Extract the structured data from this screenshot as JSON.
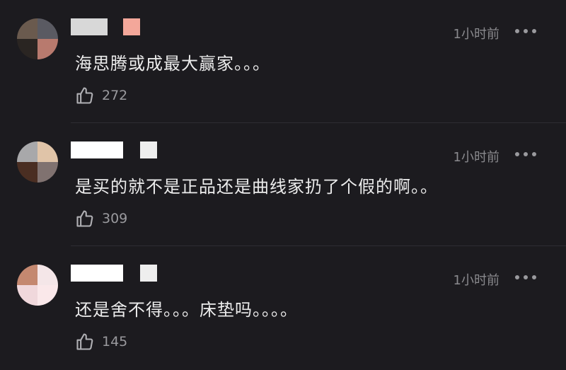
{
  "comments": [
    {
      "text": "海思腾或成最大赢家。。。",
      "time": "1小时前",
      "likes": "272",
      "avatar_colors": [
        "#6a5a4e",
        "#5a5a62",
        "#2a2522",
        "#b87a6e"
      ],
      "name_tag_color": "#f3a79a"
    },
    {
      "text": "是买的就不是正品还是曲线家扔了个假的啊。。",
      "time": "1小时前",
      "likes": "309",
      "avatar_colors": [
        "#a8a8aa",
        "#e0c4a8",
        "#4a2e22",
        "#807270"
      ],
      "name_tag_color": "#eeeeee"
    },
    {
      "text": "还是舍不得。。。床垫吗。。。。",
      "time": "1小时前",
      "likes": "145",
      "avatar_colors": [
        "#c48870",
        "#f4e6e8",
        "#f0d8dc",
        "#fae8ea"
      ],
      "name_tag_color": "#eeeeee"
    }
  ],
  "icons": {
    "like": "thumbs-up-icon",
    "more": "more-dots-icon"
  }
}
